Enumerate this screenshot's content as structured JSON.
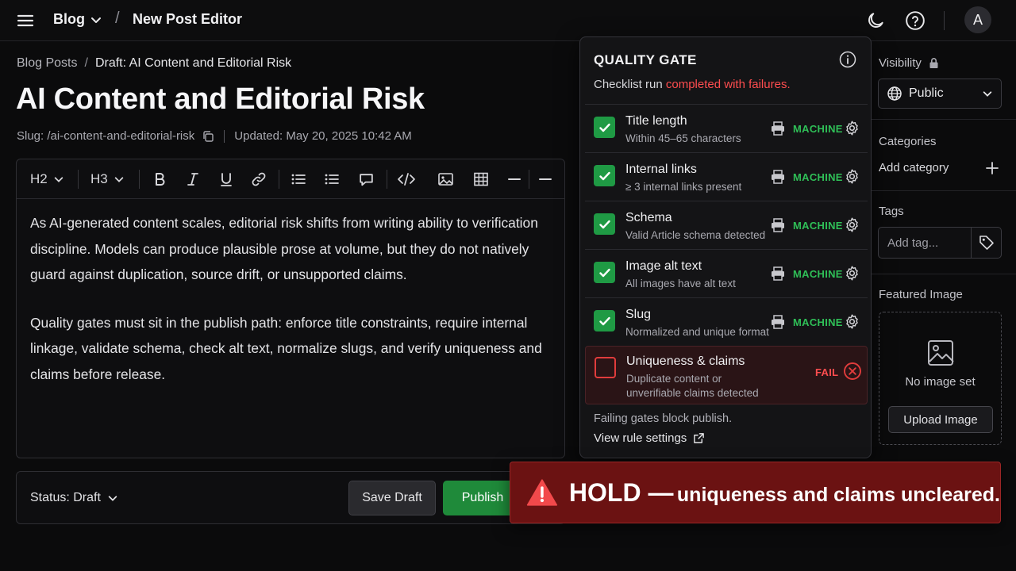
{
  "topbar": {
    "section": "Blog",
    "separator": "/",
    "page": "New Post Editor",
    "avatar_initial": "A",
    "icons": [
      "menu-icon",
      "chevron-down-icon",
      "moon-icon",
      "help-icon"
    ]
  },
  "breadcrumb": {
    "root": "Blog Posts",
    "separator": "/",
    "current": "Draft: AI Content and Editorial Risk"
  },
  "post": {
    "title": "AI Content and Editorial Risk",
    "slug": "Slug: /ai-content-and-editorial-risk",
    "updated": "Updated: May 20, 2025 10:42 AM",
    "paragraphs": [
      "As AI-generated content scales, editorial risk shifts from writing ability to verification discipline. Models can produce plausible prose at volume, but they do not natively guard against duplication, source drift, or unsupported claims.",
      "Quality gates must sit in the publish path: enforce title constraints, require internal linkage, validate schema, check alt text, normalize slugs, and verify uniqueness and claims before release."
    ]
  },
  "toolbar": {
    "h2": "H2",
    "h3": "H3",
    "buttons": [
      "bold",
      "italic",
      "underline",
      "link",
      "bulleted-list",
      "list",
      "comment",
      "code",
      "image",
      "table",
      "divider",
      "divider"
    ]
  },
  "statusbar": {
    "status": "Status: Draft",
    "save_label": "Save Draft",
    "publish_label": "Publish"
  },
  "quality_gate": {
    "title": "QUALITY GATE",
    "subtitle_prefix": "Checklist run ",
    "subtitle_status": "completed with failures.",
    "checks": [
      {
        "name": "Title length",
        "detail": "Within 45–65 characters",
        "result": "MACHINE",
        "passed": true
      },
      {
        "name": "Internal links",
        "detail": "≥ 3 internal links present",
        "result": "MACHINE",
        "passed": true
      },
      {
        "name": "Schema",
        "detail": "Valid Article schema detected",
        "result": "MACHINE",
        "passed": true
      },
      {
        "name": "Image alt text",
        "detail": "All images have alt text",
        "result": "MACHINE",
        "passed": true
      },
      {
        "name": "Slug",
        "detail": "Normalized and unique format",
        "result": "MACHINE",
        "passed": true
      },
      {
        "name": "Uniqueness & claims",
        "detail": "Duplicate content or unverifiable claims detected",
        "result": "FAIL",
        "passed": false
      }
    ],
    "footer": "Failing gates block publish.",
    "link_label": "View rule settings"
  },
  "sidebar": {
    "visibility_label": "Visibility",
    "visibility_value": "Public",
    "categories_label": "Categories",
    "add_category": "Add category",
    "tags_label": "Tags",
    "tag_placeholder": "Add tag...",
    "featured_label": "Featured Image",
    "no_image": "No image set",
    "upload_label": "Upload Image"
  },
  "hold_banner": {
    "title": "HOLD —",
    "message": "uniqueness and claims uncleared."
  },
  "colors": {
    "accent_green": "#1f8a3a",
    "pass_green": "#2fbf57",
    "fail_red": "#ff4d4f",
    "hold_bg": "#6b1212"
  }
}
